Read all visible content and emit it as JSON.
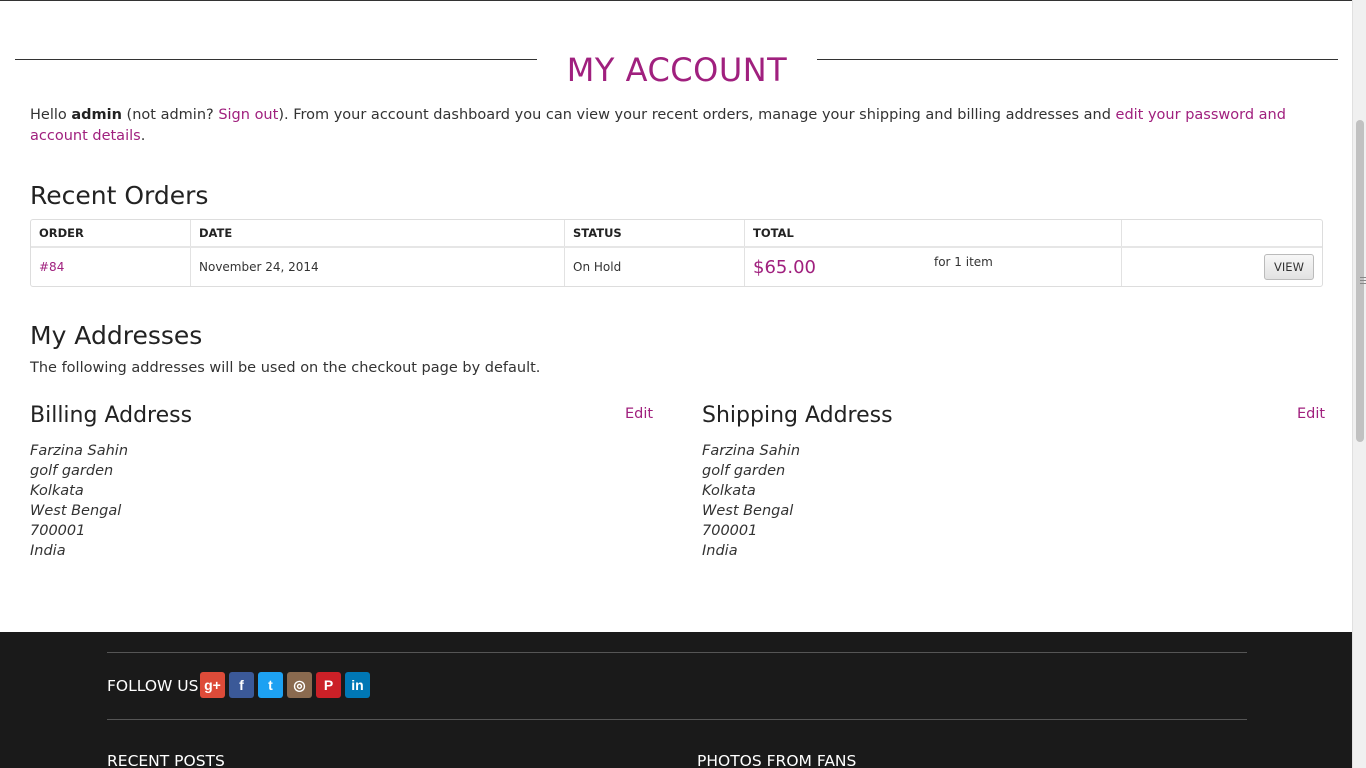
{
  "page": {
    "title": "MY ACCOUNT"
  },
  "intro": {
    "hello": "Hello ",
    "username": "admin",
    "not_user": " (not admin? ",
    "sign_out": "Sign out",
    "middle": "). From your account dashboard you can view your recent orders, manage your shipping and billing addresses and ",
    "edit_link": "edit your password and account details",
    "end": "."
  },
  "orders": {
    "heading": "Recent Orders",
    "columns": [
      "ORDER",
      "DATE",
      "STATUS",
      "TOTAL",
      ""
    ],
    "rows": [
      {
        "order": "#84",
        "date": "November 24, 2014",
        "status": "On Hold",
        "total": "$65.00",
        "items": "for 1 item",
        "action": "VIEW"
      }
    ]
  },
  "addresses": {
    "heading": "My Addresses",
    "description": "The following addresses will be used on the checkout page by default.",
    "billing": {
      "title": "Billing Address",
      "edit": "Edit",
      "lines": [
        "Farzina Sahin",
        "golf garden",
        "Kolkata",
        "West Bengal",
        "700001",
        "India"
      ]
    },
    "shipping": {
      "title": "Shipping Address",
      "edit": "Edit",
      "lines": [
        "Farzina Sahin",
        "golf garden",
        "Kolkata",
        "West Bengal",
        "700001",
        "India"
      ]
    }
  },
  "footer": {
    "follow_us": "FOLLOW US",
    "socials": [
      {
        "name": "google-plus",
        "glyph": "g+",
        "color": "#dd4b39"
      },
      {
        "name": "facebook",
        "glyph": "f",
        "color": "#3b5998"
      },
      {
        "name": "twitter",
        "glyph": "t",
        "color": "#1da1f2"
      },
      {
        "name": "instagram",
        "glyph": "◎",
        "color": "#8a6a4f"
      },
      {
        "name": "pinterest",
        "glyph": "P",
        "color": "#cb2027"
      },
      {
        "name": "linkedin",
        "glyph": "in",
        "color": "#0077b5"
      }
    ],
    "recent_posts": "RECENT POSTS",
    "photos_from_fans": "PHOTOS FROM FANS"
  },
  "colors": {
    "accent": "#a0207e",
    "footer_bg": "#1a1a1a"
  }
}
